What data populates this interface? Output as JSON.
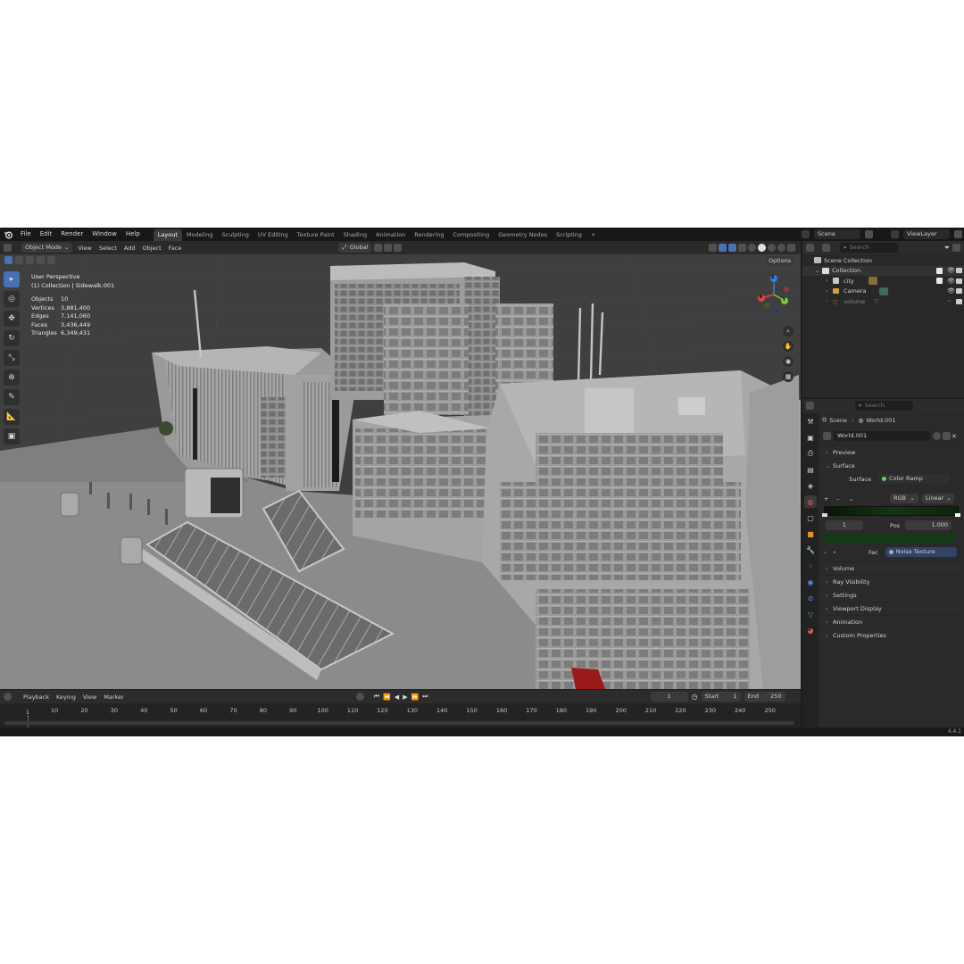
{
  "topbar": {
    "menus": [
      "File",
      "Edit",
      "Render",
      "Window",
      "Help"
    ],
    "workspaces": [
      "Layout",
      "Modeling",
      "Sculpting",
      "UV Editing",
      "Texture Paint",
      "Shading",
      "Animation",
      "Rendering",
      "Compositing",
      "Geometry Nodes",
      "Scripting"
    ],
    "active_workspace": "Layout",
    "add_tab": "+",
    "scene_name": "Scene",
    "view_layer": "ViewLayer"
  },
  "viewport": {
    "mode": "Object Mode",
    "menus": [
      "View",
      "Select",
      "Add",
      "Object",
      "Face"
    ],
    "transform_orientation": "Global",
    "options_label": "Options",
    "info_line1": "User Perspective",
    "info_line2": "(1) Collection | Sidewalk.001",
    "stats": [
      {
        "k": "Objects",
        "v": "10"
      },
      {
        "k": "Vertices",
        "v": "3,881,400"
      },
      {
        "k": "Edges",
        "v": "7,141,060"
      },
      {
        "k": "Faces",
        "v": "3,436,449"
      },
      {
        "k": "Triangles",
        "v": "6,349,431"
      }
    ],
    "gizmo_axes": {
      "x": "X",
      "y": "Y",
      "z": "Z"
    }
  },
  "outliner": {
    "search_placeholder": "Search",
    "root": "Scene Collection",
    "collection": "Collection",
    "items": [
      "city",
      "Camera",
      "volume"
    ]
  },
  "properties": {
    "search_placeholder": "Search",
    "breadcrumb_scene": "Scene",
    "breadcrumb_world": "World.001",
    "world_name": "World.001",
    "preview": "Preview",
    "surface_section": "Surface",
    "surface_label": "Surface",
    "surface_value": "Color Ramp",
    "ramp_mode": "RGB",
    "ramp_interp": "Linear",
    "ramp_index": "1",
    "pos_label": "Pos",
    "pos_value": "1.000",
    "fac_label": "Fac",
    "fac_value": "Noise Texture",
    "sections": [
      "Volume",
      "Ray Visibility",
      "Settings",
      "Viewport Display",
      "Animation",
      "Custom Properties"
    ]
  },
  "timeline": {
    "menus": [
      "Playback",
      "Keying",
      "View",
      "Marker"
    ],
    "current_frame": "1",
    "start_label": "Start",
    "start_value": "1",
    "end_label": "End",
    "end_value": "250",
    "ticks": [
      "10",
      "20",
      "30",
      "40",
      "50",
      "60",
      "70",
      "80",
      "90",
      "100",
      "110",
      "120",
      "130",
      "140",
      "150",
      "160",
      "170",
      "180",
      "190",
      "200",
      "210",
      "220",
      "230",
      "240",
      "250"
    ],
    "playhead_label": "1"
  },
  "statusbar": {
    "version": "4.4.1"
  },
  "colors": {
    "accent": "#4772b3",
    "x_axis": "#e0424a",
    "y_axis": "#7ec63a",
    "z_axis": "#3b7be0"
  }
}
